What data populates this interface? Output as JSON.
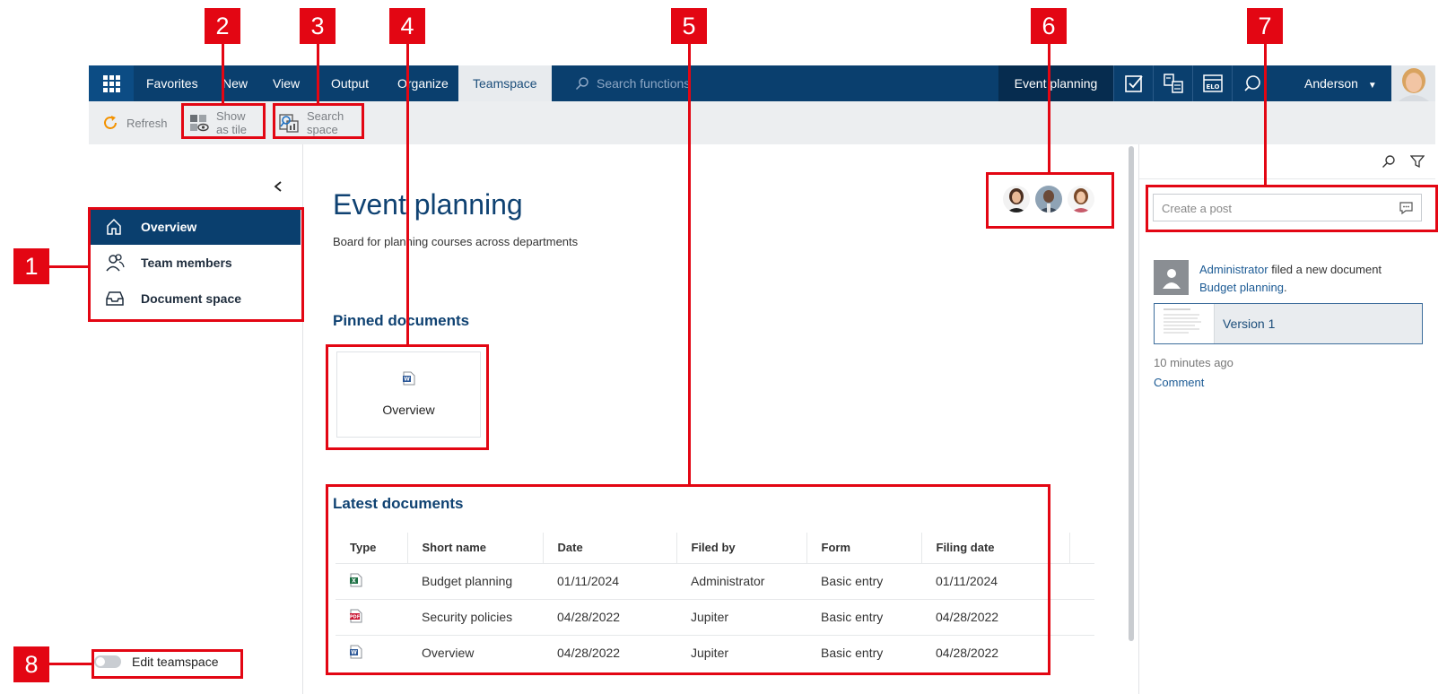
{
  "topbar": {
    "nav_items": [
      "Favorites",
      "New",
      "View",
      "Output",
      "Organize"
    ],
    "active_tab": "Teamspace",
    "search_placeholder": "Search functions",
    "context_label": "Event planning",
    "user_name": "Anderson"
  },
  "ribbon": {
    "refresh": "Refresh",
    "show_tile": [
      "Show",
      "as tile"
    ],
    "search_space": [
      "Search",
      "space"
    ]
  },
  "sidebar": {
    "items": [
      {
        "label": "Overview",
        "icon": "home-icon",
        "active": true
      },
      {
        "label": "Team members",
        "icon": "team-icon",
        "active": false
      },
      {
        "label": "Document space",
        "icon": "inbox-icon",
        "active": false
      }
    ],
    "edit_toggle_label": "Edit teamspace"
  },
  "main": {
    "title": "Event planning",
    "subtitle": "Board for planning courses across departments",
    "pinned_title": "Pinned documents",
    "pinned_tile_label": "Overview",
    "latest_title": "Latest documents",
    "table": {
      "headers": [
        "Type",
        "Short name",
        "Date",
        "Filed by",
        "Form",
        "Filing date"
      ],
      "rows": [
        {
          "type": "excel",
          "short_name": "Budget planning",
          "date": "01/11/2024",
          "filed_by": "Administrator",
          "form": "Basic entry",
          "filing_date": "01/11/2024"
        },
        {
          "type": "pdf",
          "short_name": "Security policies",
          "date": "04/28/2022",
          "filed_by": "Jupiter",
          "form": "Basic entry",
          "filing_date": "04/28/2022"
        },
        {
          "type": "word",
          "short_name": "Overview",
          "date": "04/28/2022",
          "filed_by": "Jupiter",
          "form": "Basic entry",
          "filing_date": "04/28/2022"
        }
      ]
    }
  },
  "feed": {
    "post_placeholder": "Create a post",
    "entry": {
      "actor": "Administrator",
      "action": " filed a new document",
      "document": "Budget planning",
      "suffix": ".",
      "version": "Version 1",
      "time": "10 minutes ago",
      "comment": "Comment"
    }
  },
  "annotations": [
    "1",
    "2",
    "3",
    "4",
    "5",
    "6",
    "7",
    "8"
  ],
  "colors": {
    "nav_bg": "#0a3f6e",
    "accent_title": "#0f4272",
    "highlight": "#e30613",
    "refresh_icon": "#f39200"
  }
}
